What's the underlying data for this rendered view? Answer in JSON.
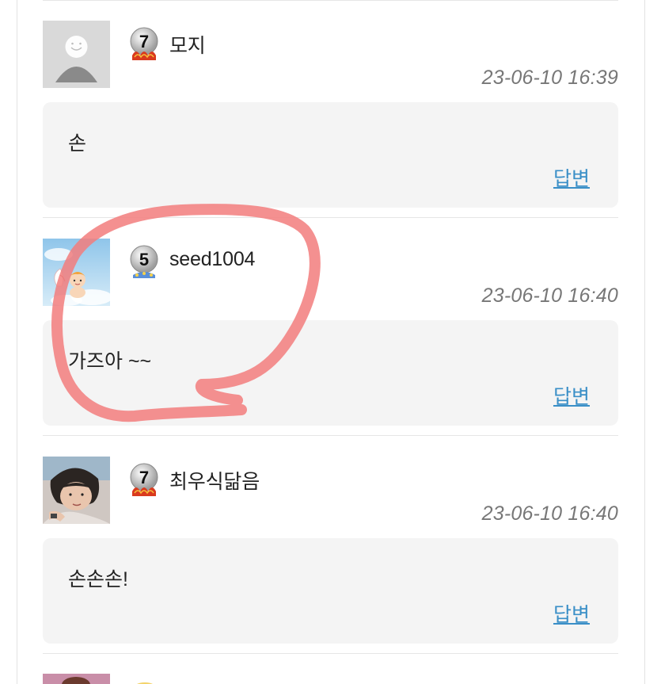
{
  "comments": [
    {
      "author": "모지",
      "level": "7",
      "timestamp": "23-06-10 16:39",
      "body": "손",
      "reply_label": "답변",
      "avatar": "default-user-silhouette"
    },
    {
      "author": "seed1004",
      "level": "5",
      "timestamp": "23-06-10 16:40",
      "body": "가즈아 ~~",
      "reply_label": "답변",
      "avatar": "cherub-angel-image"
    },
    {
      "author": "최우식닮음",
      "level": "7",
      "timestamp": "23-06-10 16:40",
      "body": "손손손!",
      "reply_label": "답변",
      "avatar": "person-photo"
    }
  ],
  "colors": {
    "reply_link": "#3a8fc7",
    "bubble_bg": "#f4f4f4",
    "timestamp": "#777777",
    "annotation_stroke": "#f27c7c"
  }
}
